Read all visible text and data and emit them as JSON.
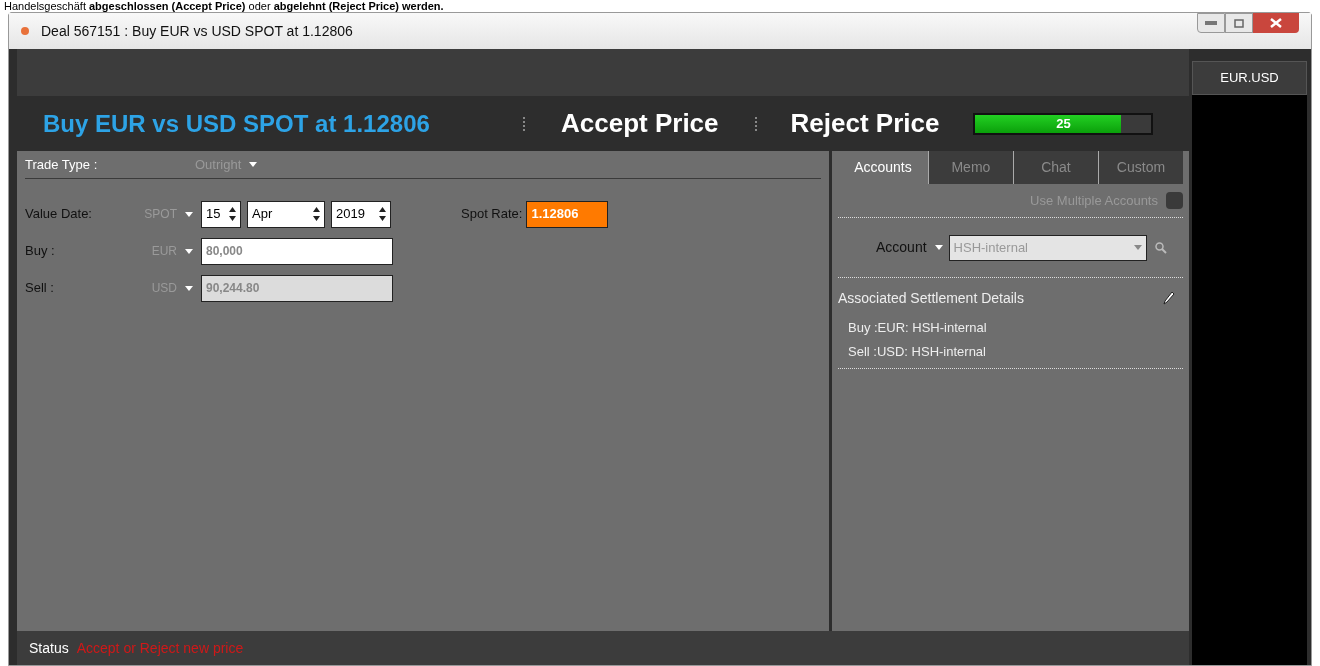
{
  "caption": "Handelsgeschäft **abgeschlossen (Accept Price)** oder **abgelehnt (Reject Price) werden.**",
  "window": {
    "title": "Deal 567151 : Buy EUR vs USD SPOT at 1.12806"
  },
  "header": {
    "headline": "Buy EUR vs USD SPOT at 1.12806",
    "actions": [
      "Accept Price",
      "Reject Price"
    ],
    "timer": {
      "level": 0.83,
      "reading": "25"
    }
  },
  "side_tab": {
    "label": "EUR.USD"
  },
  "form": {
    "trade_type": {
      "label": "Trade Type :",
      "value": "Outright"
    },
    "value_date": {
      "label": "Value Date:",
      "tenor": "SPOT",
      "day": "15",
      "month": "Apr",
      "year": "2019"
    },
    "spot_rate": {
      "label": "Spot Rate:",
      "value": "1.12806"
    },
    "legs": [
      {
        "label": "Buy :",
        "currency": "EUR",
        "amount": "80,000",
        "disabled": false
      },
      {
        "label": "Sell :",
        "currency": "USD",
        "amount": "90,244.80",
        "disabled": true
      }
    ]
  },
  "tabs": [
    {
      "label": "Accounts",
      "selected": true
    },
    {
      "label": "Memo",
      "selected": false
    },
    {
      "label": "Chat",
      "selected": false
    },
    {
      "label": "Custom",
      "selected": false
    }
  ],
  "accounts": {
    "multiple": {
      "label": "Use Multiple Accounts",
      "checked": false
    },
    "account_label": "Account",
    "account_value": "HSH-internal",
    "settlement_title": "Associated Settlement Details",
    "settlements": [
      "Buy :EUR: HSH-internal",
      "Sell :USD: HSH-internal"
    ]
  },
  "status_bar": {
    "label": "Status",
    "message": "Accept or Reject new price"
  }
}
